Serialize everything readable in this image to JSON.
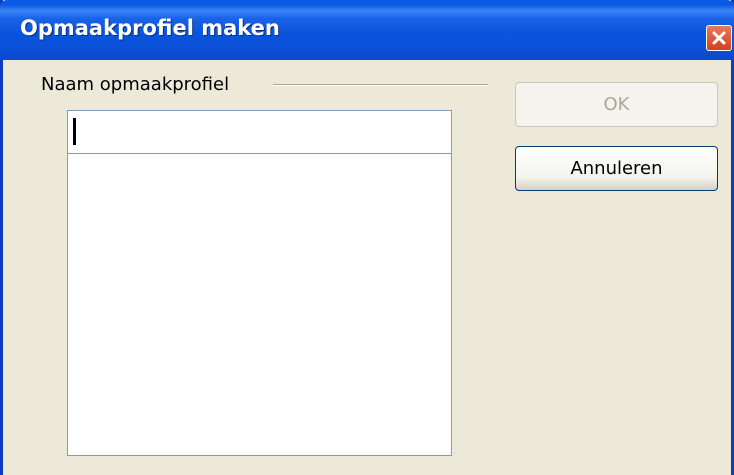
{
  "window": {
    "title": "Opmaakprofiel maken",
    "close_icon": "close-icon"
  },
  "form": {
    "group_label": "Naam opmaakprofiel",
    "name_input_value": "",
    "style_list_items": []
  },
  "buttons": {
    "ok_label": "OK",
    "ok_enabled": false,
    "cancel_label": "Annuleren"
  },
  "colors": {
    "titlebar": "#0a54de",
    "dialog_bg": "#ece9d8",
    "close_button": "#d2411f",
    "input_border": "#7f9db9"
  }
}
